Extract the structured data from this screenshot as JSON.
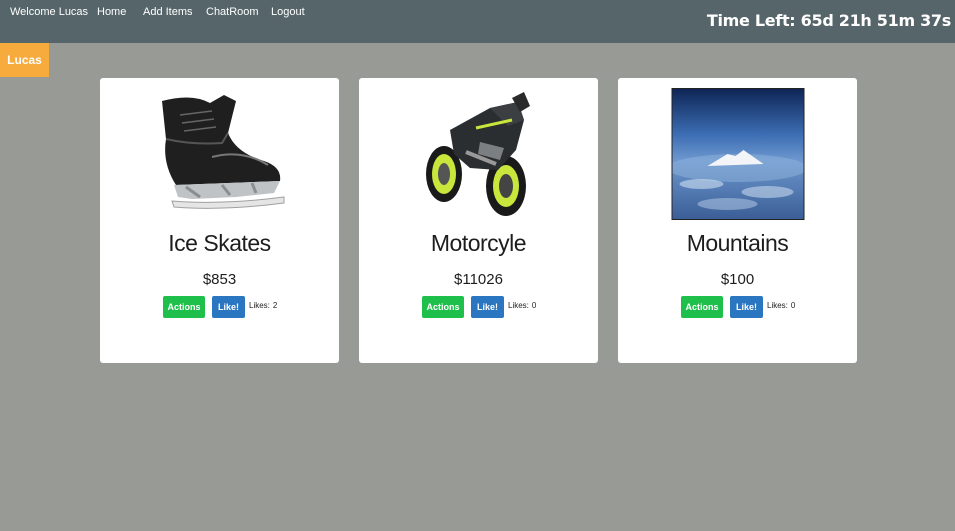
{
  "nav": {
    "welcome_label": "Welcome Lucas",
    "home_label": "Home",
    "add_items_label": "Add Items",
    "chatroom_label": "ChatRoom",
    "logout_label": "Logout",
    "timer_text": "Time Left: 65d 21h 51m 37s"
  },
  "user_tab": {
    "label": "Lucas"
  },
  "items": [
    {
      "title": "Ice Skates",
      "price": "$853",
      "actions_label": "Actions",
      "like_label": "Like!",
      "likes_label": "Likes:",
      "likes_count": "2",
      "image_icon": "ice-skate"
    },
    {
      "title": "Motorcyle",
      "price": "$11026",
      "actions_label": "Actions",
      "like_label": "Like!",
      "likes_label": "Likes:",
      "likes_count": "0",
      "image_icon": "motorcycle"
    },
    {
      "title": "Mountains",
      "price": "$100",
      "actions_label": "Actions",
      "like_label": "Like!",
      "likes_label": "Likes:",
      "likes_count": "0",
      "image_icon": "mountain-photo"
    }
  ],
  "colors": {
    "navbar": "#56656a",
    "background": "#989a96",
    "user_tab": "#f7ab3c",
    "actions_button": "#1fbf4c",
    "like_button": "#2a76c0"
  }
}
